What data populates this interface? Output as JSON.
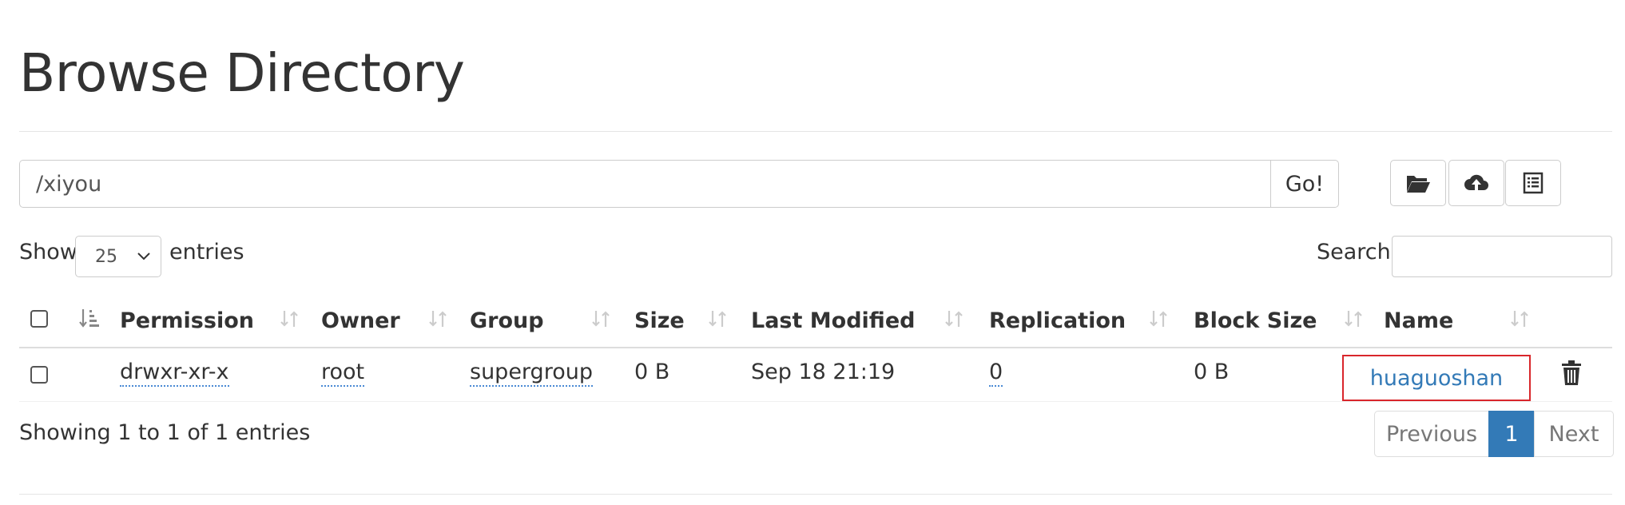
{
  "page": {
    "title": "Browse Directory"
  },
  "toolbar": {
    "path_value": "/xiyou",
    "go_label": "Go!",
    "buttons": [
      {
        "icon": "folder-open-icon"
      },
      {
        "icon": "cloud-upload-icon"
      },
      {
        "icon": "list-icon"
      }
    ]
  },
  "controls": {
    "show_label": "Show",
    "entries_value": "25",
    "entries_label": "entries",
    "search_label": "Search:",
    "search_value": ""
  },
  "table": {
    "columns": [
      "Permission",
      "Owner",
      "Group",
      "Size",
      "Last Modified",
      "Replication",
      "Block Size",
      "Name"
    ],
    "rows": [
      {
        "permission": "drwxr-xr-x",
        "owner": "root",
        "group": "supergroup",
        "size": "0 B",
        "last_modified": "Sep 18 21:19",
        "replication": "0",
        "block_size": "0 B",
        "name": "huaguoshan"
      }
    ]
  },
  "footer": {
    "info": "Showing 1 to 1 of 1 entries",
    "pagination": {
      "previous": "Previous",
      "current": "1",
      "next": "Next"
    }
  },
  "colors": {
    "link": "#337ab7",
    "highlight_border": "#d9262b",
    "active_page": "#337ab7"
  }
}
